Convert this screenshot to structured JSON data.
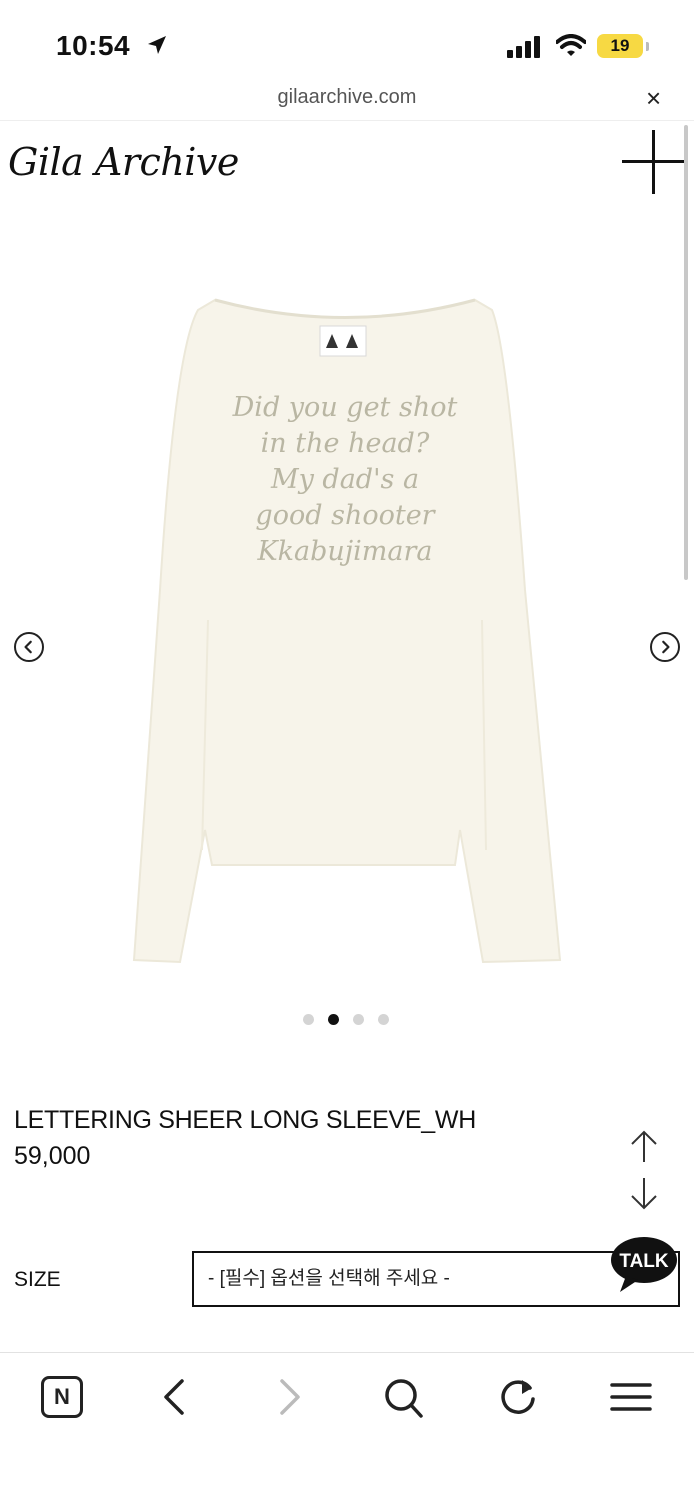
{
  "status_bar": {
    "time": "10:54",
    "battery": "19"
  },
  "browser": {
    "url": "gilaarchive.com",
    "close_label": "×"
  },
  "header": {
    "logo": "Gila Archive"
  },
  "product": {
    "image_lettering": [
      "Did you get shot",
      "in the head?",
      "My dad's a",
      "good shooter",
      "Kkabujimara"
    ],
    "name": "LETTERING SHEER LONG SLEEVE_WH",
    "price": "59,000",
    "carousel": {
      "total": 4,
      "active_index": 1
    }
  },
  "options": {
    "size_label": "SIZE",
    "size_placeholder": "- [필수] 옵션을 선택해 주세요 -"
  },
  "chat": {
    "label": "TALK"
  },
  "toolbar": {
    "naver_label": "N"
  },
  "colors": {
    "shirt": "#f7f4ea",
    "lettering": "#b9b6a3",
    "battery": "#f7d943"
  }
}
